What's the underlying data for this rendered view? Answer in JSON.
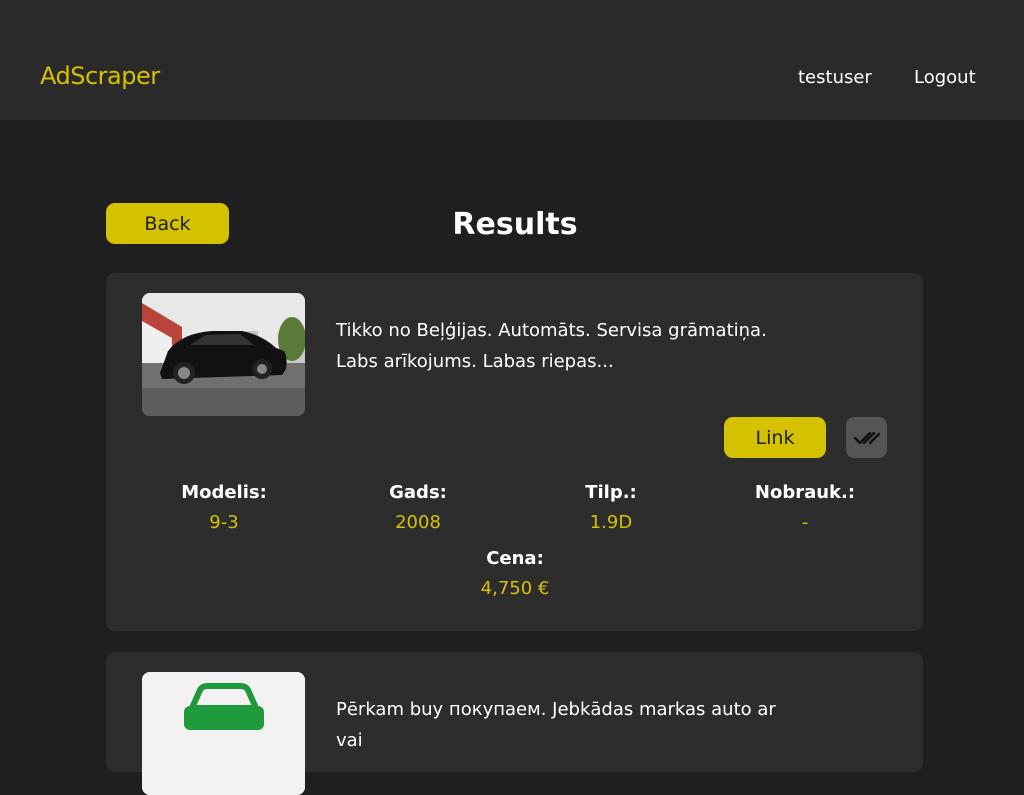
{
  "navbar": {
    "brand": "AdScraper",
    "username": "testuser",
    "logout_label": "Logout"
  },
  "page": {
    "back_label": "Back",
    "title": "Results"
  },
  "results": [
    {
      "description_line1": "Tikko no Beļģijas. Automāts. Servisa grāmatiņa.",
      "description_line2": "Labs arīkojums. Labas riepas...",
      "link_label": "Link",
      "specs": {
        "model_label": "Modelis:",
        "model_value": "9-3",
        "year_label": "Gads:",
        "year_value": "2008",
        "engine_label": "Tilp.:",
        "engine_value": "1.9D",
        "mileage_label": "Nobrauk.:",
        "mileage_value": "-",
        "price_label": "Cena:",
        "price_value": "4,750 €"
      }
    },
    {
      "description_line1": "Pērkam buy покупаем. Jebkādas markas auto ar vai"
    }
  ],
  "icons": {
    "check": "double-check-icon",
    "car_placeholder": "car-icon"
  },
  "colors": {
    "accent": "#d4c200",
    "background": "#1f1f1f",
    "navbar": "#2a2a2a",
    "card": "#2d2d2d",
    "check_button": "#555555"
  }
}
